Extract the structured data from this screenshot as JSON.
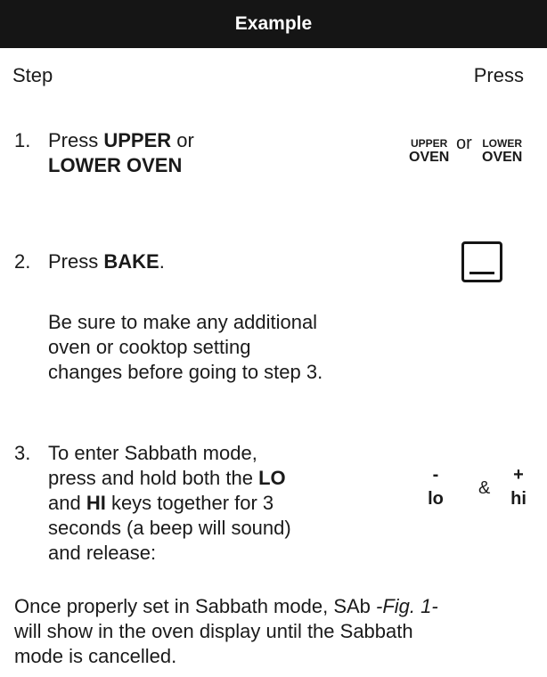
{
  "header": {
    "title": "Example"
  },
  "columns": {
    "step": "Step",
    "press": "Press"
  },
  "steps": [
    {
      "num": "1.",
      "line1_pre": "Press ",
      "line1_bold": "UPPER",
      "line1_post": " or",
      "line2_bold": "LOWER OVEN"
    },
    {
      "num": "2.",
      "line1_pre": "Press ",
      "line1_bold": "BAKE",
      "line1_post": ".",
      "note": [
        "Be sure to make any additional",
        "oven or cooktop setting",
        "changes before going to step 3."
      ]
    },
    {
      "num": "3.",
      "l1": "To enter Sabbath mode,",
      "l2_pre": "press and hold both the ",
      "l2_bold": "LO",
      "l3_pre": "and ",
      "l3_bold": "HI",
      "l3_post": " keys together for 3",
      "l4": "seconds (a beep will sound)",
      "l5": "and release:"
    }
  ],
  "keys": {
    "upper_small": "UPPER",
    "upper_big": "OVEN",
    "or": "or",
    "lower_small": "LOWER",
    "lower_big": "OVEN",
    "lo_sign": "-",
    "lo": "lo",
    "amp": "&",
    "hi_sign": "+",
    "hi": "hi"
  },
  "footer": {
    "l1_pre": "Once properly set in Sabbath mode, SAb ",
    "l1_fig": "-Fig. 1-",
    "l2": "will show in the oven display until  the Sabbath",
    "l3": "mode is cancelled."
  }
}
